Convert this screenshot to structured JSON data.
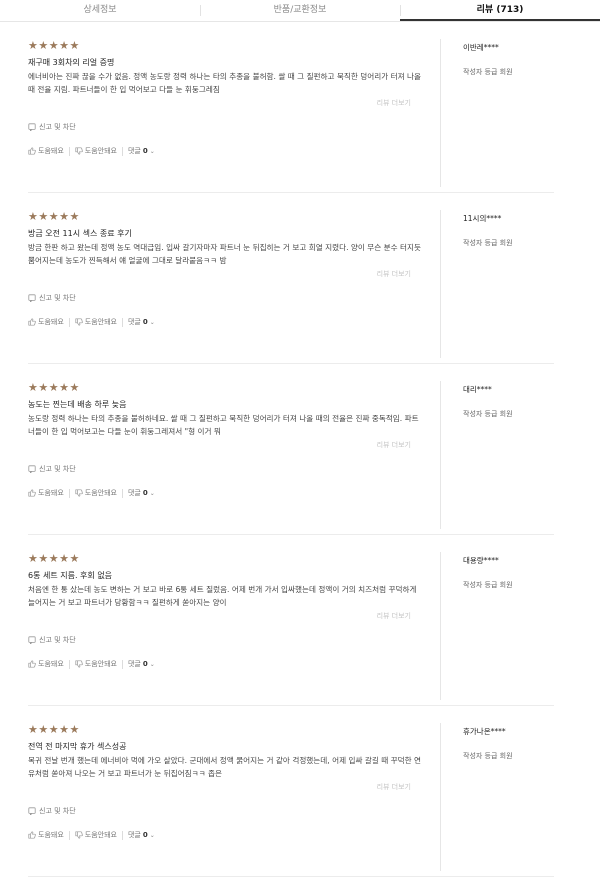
{
  "tabs": [
    {
      "label": "상세정보",
      "active": false
    },
    {
      "label": "반품/교환정보",
      "active": false
    },
    {
      "label": "리뷰 (713)",
      "active": true
    }
  ],
  "common": {
    "stars": "★★★★★",
    "more_label": "리뷰 더보기",
    "report_label": "신고 및 차단",
    "helpful_label": "도움돼요",
    "not_helpful_label": "도움안돼요",
    "comment_label": "댓글",
    "grade_label": "작성자 등급 회원",
    "star_color": "#9b7a5b"
  },
  "reviews": [
    {
      "rating": 5,
      "title": "재구매 3회차의 리얼 증명",
      "body": "에너비아는 진짜 끊을 수가 없음. 정액 농도랑 정력 하나는 타의 추종을 불허함. 쌀 때 그 질펀하고 묵직한 덩어리가 터져 나올 때 전율 지림. 파트너들이 한 입 먹어보고 다들 눈 휘둥그레짐",
      "comment_count": "0",
      "author": "이반레****"
    },
    {
      "rating": 5,
      "title": "방금 오전 11시 섹스 종료 후기",
      "body": "방금 한판 하고 왔는데 정액 농도 역대급임. 입싸 갈기자마자 파트너 눈 뒤집히는 거 보고 희열 지렸다. 양이 무슨 분수 터지듯 뿜어지는데 농도가 찐득해서 얘 얼굴에 그대로 달라붙음ㅋㅋ 밤",
      "comment_count": "0",
      "author": "11시의****"
    },
    {
      "rating": 5,
      "title": "농도는 찐는데 배송 하루 늦음",
      "body": "농도랑 정력 하나는 타의 추종을 불허하네요. 쌀 때 그 질펀하고 묵직한 덩어리가 터져 나올 때의 전율은 진짜 중독적임. 파트너들이 한 입 먹어보고는 다들 눈이 휘둥그레져서 \"형 이거 뭐",
      "comment_count": "0",
      "author": "대리****"
    },
    {
      "rating": 5,
      "title": "6통 세트 지름. 후회 없음",
      "body": "처음엔 한 통 샀는데 농도 변하는 거 보고 바로 6통 세트 질렀음. 어제 번개 가서 입싸했는데 정액이 거의 치즈처럼 꾸덕하게 늘어지는 거 보고 파트너가 당황함ㅋㅋ 질펀하게 쏟아지는 양이",
      "comment_count": "0",
      "author": "대용량****"
    },
    {
      "rating": 5,
      "title": "전역 전 마지막 휴가 섹스성공",
      "body": "복귀 전날 번개 했는데 에너비아 먹에 가오 살았다. 군대에서 정액 묽어지는 거 같아 걱정했는데, 어제 입싸 갈길 때 꾸덕한 연유처럼 쏟아져 나오는 거 보고 파트너가 눈 뒤집어짐ㅋㅋ 좁은",
      "comment_count": "0",
      "author": "휴가나온****"
    }
  ]
}
